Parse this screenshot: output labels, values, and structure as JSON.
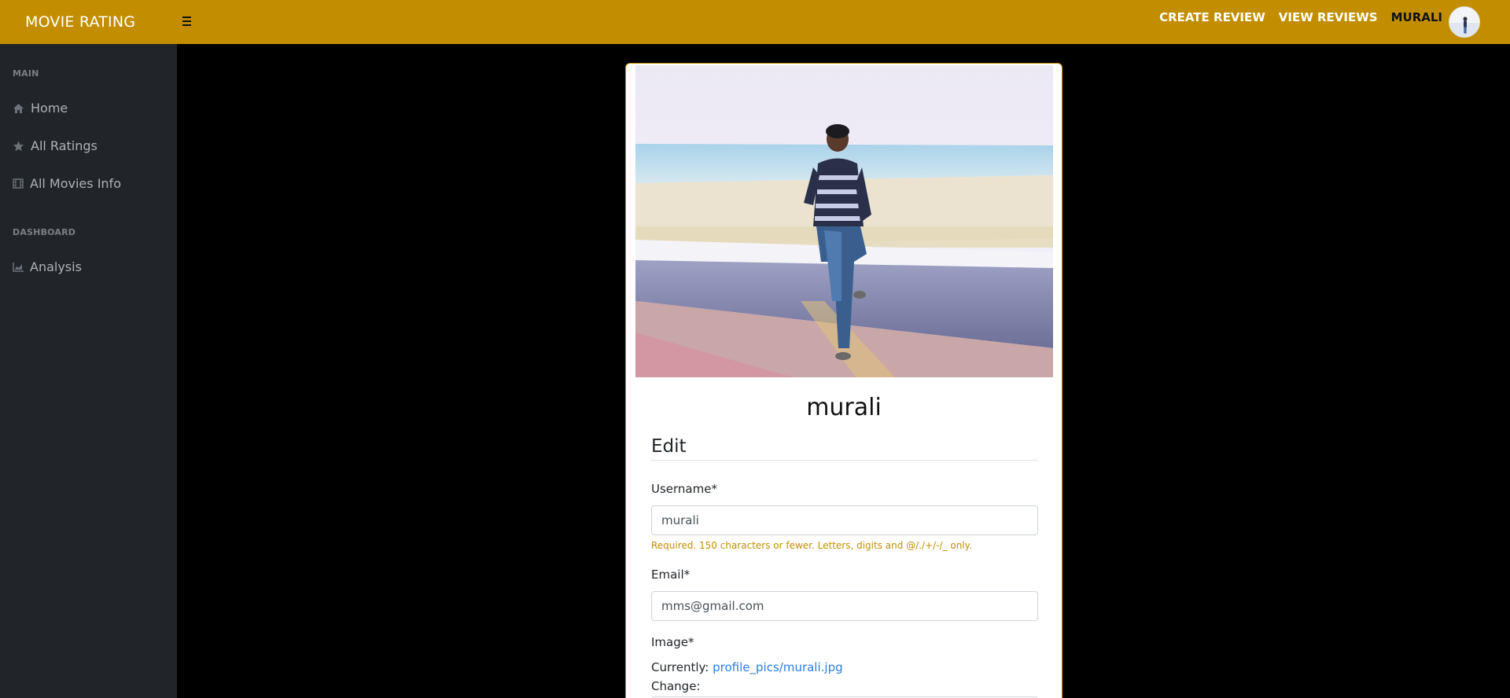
{
  "brand": "MOVIE RATING",
  "topnav": {
    "create_review": "CREATE REVIEW",
    "view_reviews": "VIEW REVIEWS",
    "user": "MURALI"
  },
  "sidebar": {
    "headings": [
      "MAIN",
      "DASHBOARD"
    ],
    "items": [
      {
        "label": "Home",
        "icon": "home-icon"
      },
      {
        "label": "All Ratings",
        "icon": "star-icon"
      },
      {
        "label": "All Movies Info",
        "icon": "film-icon"
      },
      {
        "label": "Analysis",
        "icon": "chart-icon"
      }
    ]
  },
  "profile": {
    "name": "murali",
    "section_title": "Edit",
    "username_label": "Username*",
    "username_value": "murali",
    "username_help": "Required. 150 characters or fewer. Letters, digits and @/./+/-/_ only.",
    "email_label": "Email*",
    "email_value": "mms@gmail.com",
    "image_label": "Image*",
    "currently_label": "Currently:",
    "currently_value": "profile_pics/murali.jpg",
    "change_label": "Change:"
  },
  "colors": {
    "accent": "#c28e00",
    "sidebar_bg": "#212529",
    "page_bg": "#000000",
    "link": "#2a7de1"
  }
}
